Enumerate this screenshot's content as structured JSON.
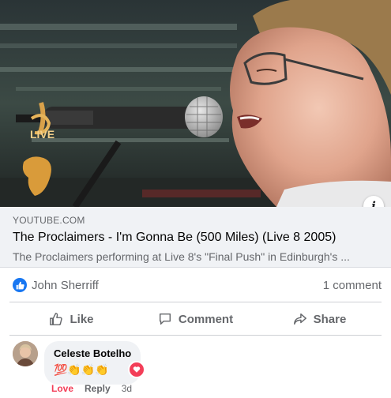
{
  "link_preview": {
    "domain": "YOUTUBE.COM",
    "title": "The Proclaimers - I'm Gonna Be (500 Miles) (Live 8 2005)",
    "description": "The Proclaimers performing at Live 8's \"Final Push\" in Edinburgh's ...",
    "info_icon": "info-icon",
    "logo_text": "LIVE"
  },
  "reactions": {
    "icon": "like-icon",
    "names": "John Sherriff",
    "comment_count": "1 comment"
  },
  "actions": {
    "like": "Like",
    "comment": "Comment",
    "share": "Share"
  },
  "comment": {
    "author": "Celeste Botelho",
    "text": "💯👏👏👏",
    "reaction_icon": "heart-icon",
    "love_label": "Love",
    "reply_label": "Reply",
    "time": "3d"
  },
  "colors": {
    "facebook_blue": "#1877f2",
    "love_red": "#f33e58",
    "secondary_text": "#65676b"
  }
}
